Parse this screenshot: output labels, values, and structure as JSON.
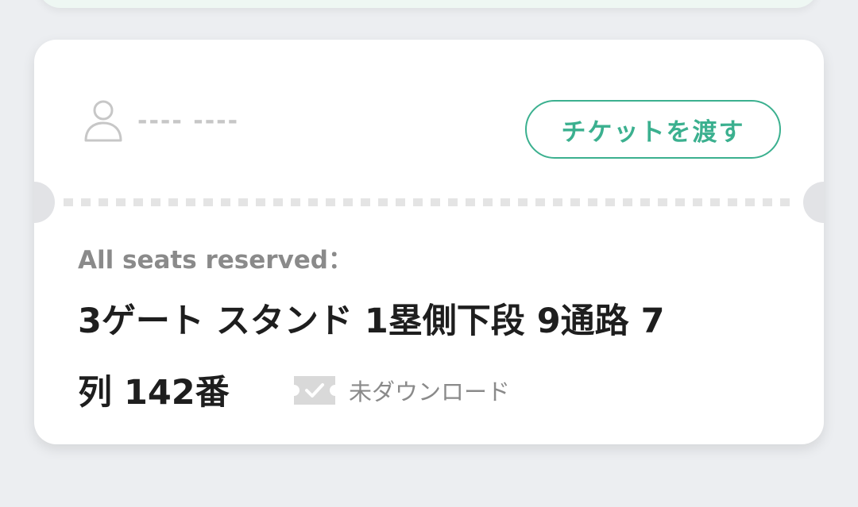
{
  "ticket": {
    "holder_name": "---- ----",
    "transfer_button_label": "チケットを渡す",
    "seat_caption": "All seats reserved：",
    "seat_line1": "3ゲート スタンド 1塁側下段 9通路 7",
    "seat_line2": "列 142番",
    "download_status": "未ダウンロード"
  },
  "icons": {
    "holder": "person-icon",
    "download": "ticket-check-icon"
  },
  "colors": {
    "accent": "#3bb08f",
    "muted_text": "#8a8a8a",
    "primary_text": "#1e1e1e",
    "placeholder": "#c7c7c7",
    "background": "#eceef1",
    "top_card": "#eef7f3"
  }
}
